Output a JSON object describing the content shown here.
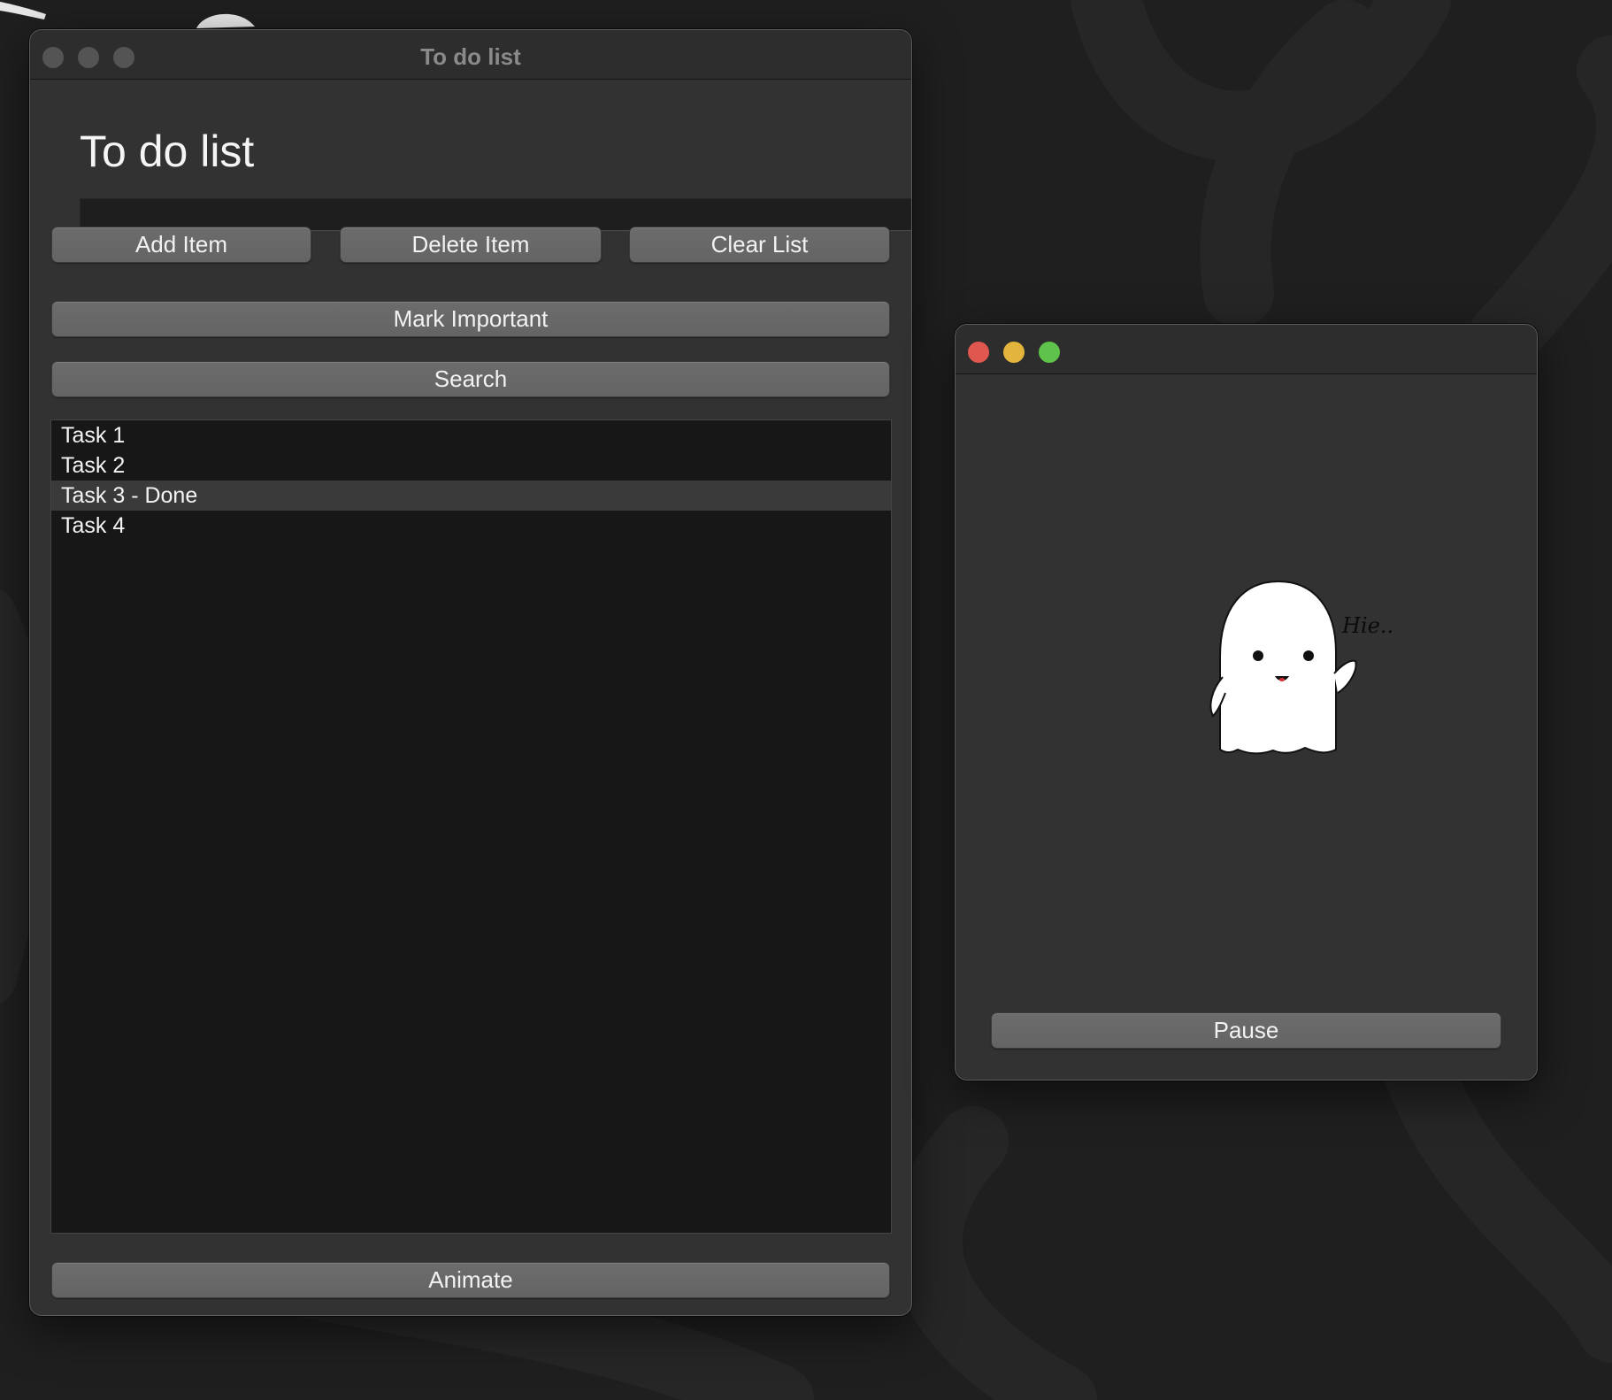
{
  "todo_window": {
    "title": "To do list",
    "heading": "To do list",
    "input_value": "",
    "buttons": {
      "add": "Add Item",
      "delete": "Delete Item",
      "clear": "Clear List",
      "mark_important": "Mark Important",
      "search": "Search",
      "animate": "Animate"
    },
    "list_items": [
      {
        "label": "Task 1",
        "selected": false
      },
      {
        "label": "Task 2",
        "selected": false
      },
      {
        "label": "Task 3 - Done",
        "selected": true
      },
      {
        "label": "Task 4",
        "selected": false
      }
    ]
  },
  "animation_window": {
    "title": "",
    "ghost_caption": "Hie..",
    "pause_button": "Pause"
  },
  "colors": {
    "traffic_close": "#e0574f",
    "traffic_minimize": "#e3b53d",
    "traffic_zoom": "#5fc34b",
    "traffic_inactive": "#545454",
    "desktop": "#1f1f1f"
  },
  "icons": [
    "close-icon",
    "minimize-icon",
    "zoom-icon",
    "ghost-icon"
  ]
}
